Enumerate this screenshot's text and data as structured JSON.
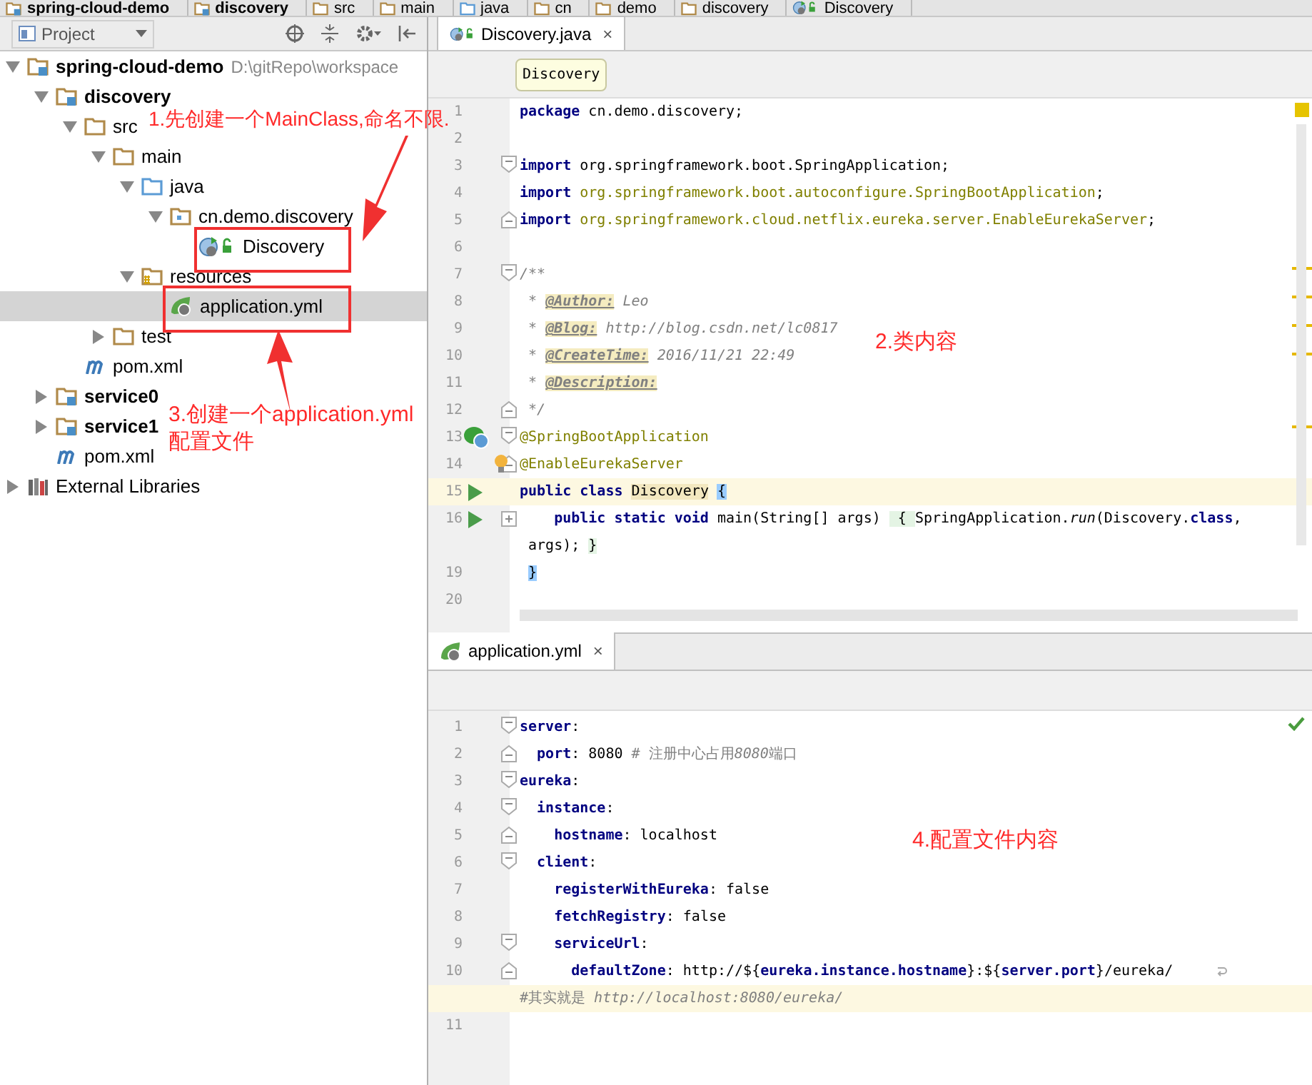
{
  "breadcrumbs": [
    {
      "label": "spring-cloud-demo",
      "kind": "module"
    },
    {
      "label": "discovery",
      "kind": "module"
    },
    {
      "label": "src",
      "kind": "folder"
    },
    {
      "label": "main",
      "kind": "folder"
    },
    {
      "label": "java",
      "kind": "source"
    },
    {
      "label": "cn",
      "kind": "folder"
    },
    {
      "label": "demo",
      "kind": "folder"
    },
    {
      "label": "discovery",
      "kind": "folder"
    },
    {
      "label": "Discovery",
      "kind": "spring-class"
    }
  ],
  "project_panel": {
    "title": "Project",
    "tree": [
      {
        "label": "spring-cloud-demo",
        "kind": "module",
        "detail": "D:\\gitRepo\\workspace",
        "expanded": true,
        "selected": false,
        "children": [
          {
            "label": "discovery",
            "kind": "module",
            "expanded": true,
            "selected": false,
            "children": [
              {
                "label": "src",
                "kind": "folder",
                "expanded": true,
                "selected": false,
                "children": [
                  {
                    "label": "main",
                    "kind": "folder",
                    "expanded": true,
                    "selected": false,
                    "children": [
                      {
                        "label": "java",
                        "kind": "source",
                        "expanded": true,
                        "selected": false,
                        "children": [
                          {
                            "label": "cn.demo.discovery",
                            "kind": "package",
                            "expanded": true,
                            "selected": false,
                            "children": [
                              {
                                "label": "Discovery",
                                "kind": "spring-class",
                                "selected": false
                              }
                            ]
                          }
                        ]
                      },
                      {
                        "label": "resources",
                        "kind": "resources",
                        "expanded": true,
                        "selected": false,
                        "children": [
                          {
                            "label": "application.yml",
                            "kind": "yml",
                            "selected": true
                          }
                        ]
                      }
                    ]
                  },
                  {
                    "label": "test",
                    "kind": "folder",
                    "expanded": false,
                    "selected": false
                  }
                ]
              },
              {
                "label": "pom.xml",
                "kind": "maven",
                "selected": false
              }
            ]
          },
          {
            "label": "service0",
            "kind": "module",
            "expanded": false,
            "selected": false
          },
          {
            "label": "service1",
            "kind": "module",
            "expanded": false,
            "selected": false
          },
          {
            "label": "pom.xml",
            "kind": "maven",
            "selected": false
          }
        ]
      },
      {
        "label": "External Libraries",
        "kind": "library",
        "expanded": false,
        "selected": false
      }
    ]
  },
  "editor_java": {
    "tab": {
      "label": "Discovery.java",
      "close": "×"
    },
    "crumb": "Discovery",
    "lines": [
      {
        "number": "1",
        "tokens": [
          {
            "kind": "keyword",
            "text": "package"
          },
          {
            "kind": "plain",
            "text": " cn.demo.discovery;"
          }
        ]
      },
      {
        "number": "2"
      },
      {
        "number": "3",
        "fold_start": true,
        "tokens": [
          {
            "kind": "keyword",
            "text": "import"
          },
          {
            "kind": "plain",
            "text": " org.springframework.boot.SpringApplication;"
          }
        ]
      },
      {
        "number": "4",
        "tokens": [
          {
            "kind": "keyword",
            "text": "import"
          },
          {
            "kind": "unused",
            "text": " org.springframework.boot.autoconfigure.SpringBootApplication"
          },
          {
            "kind": "plain",
            "text": ";"
          }
        ]
      },
      {
        "number": "5",
        "fold_end": true,
        "tokens": [
          {
            "kind": "keyword",
            "text": "import"
          },
          {
            "kind": "unused",
            "text": " org.springframework.cloud.netflix.eureka.server.EnableEurekaServer"
          },
          {
            "kind": "plain",
            "text": ";"
          }
        ]
      },
      {
        "number": "6"
      },
      {
        "number": "7",
        "fold_start": true,
        "tokens": [
          {
            "kind": "doc",
            "text": "/**"
          }
        ]
      },
      {
        "number": "8",
        "tokens": [
          {
            "kind": "doc",
            "text": " * "
          },
          {
            "kind": "doctag",
            "text": "@Author:"
          },
          {
            "kind": "doc",
            "text": " Leo"
          }
        ]
      },
      {
        "number": "9",
        "tokens": [
          {
            "kind": "doc",
            "text": " * "
          },
          {
            "kind": "doctag",
            "text": "@Blog:"
          },
          {
            "kind": "doc",
            "text": " http://blog.csdn.net/lc0817"
          }
        ]
      },
      {
        "number": "10",
        "tokens": [
          {
            "kind": "doc",
            "text": " * "
          },
          {
            "kind": "doctag",
            "text": "@CreateTime:"
          },
          {
            "kind": "doc",
            "text": " 2016/11/21 22:49"
          }
        ]
      },
      {
        "number": "11",
        "tokens": [
          {
            "kind": "doc",
            "text": " * "
          },
          {
            "kind": "doctag",
            "text": "@Description:"
          }
        ]
      },
      {
        "number": "12",
        "fold_end": true,
        "tokens": [
          {
            "kind": "doc",
            "text": " */"
          }
        ]
      },
      {
        "number": "13",
        "bean_marker": true,
        "fold_start": true,
        "tokens": [
          {
            "kind": "annotation",
            "text": "@SpringBootApplication"
          }
        ]
      },
      {
        "number": "14",
        "fold_end": true,
        "intention": true,
        "tokens": [
          {
            "kind": "annotation",
            "text": "@EnableEurekaServer"
          }
        ]
      },
      {
        "number": "15",
        "run_marker": true,
        "current": true,
        "tokens": [
          {
            "kind": "keyword",
            "text": "public class "
          },
          {
            "kind": "usage",
            "text": "Discovery"
          },
          {
            "kind": "brace",
            "text": "{"
          }
        ]
      },
      {
        "number": "16",
        "run_marker": true,
        "folded": true,
        "tokens": [
          {
            "kind": "keyword",
            "text": "    public static void"
          },
          {
            "kind": "plain",
            "text": " main(String[] args) "
          },
          {
            "kind": "folded",
            "text": " { "
          },
          {
            "kind": "plain",
            "text": "SpringApplication."
          },
          {
            "kind": "italic",
            "text": "run"
          },
          {
            "kind": "plain",
            "text": "(Discovery."
          },
          {
            "kind": "keyword",
            "text": "class"
          },
          {
            "kind": "plain",
            "text": ","
          }
        ]
      },
      {
        "tokens": [
          {
            "kind": "plain",
            "text": " args); "
          },
          {
            "kind": "folded",
            "text": "}"
          }
        ]
      },
      {
        "number": "19",
        "tokens": [
          {
            "kind": "brace",
            "text": "}"
          }
        ]
      },
      {
        "number": "20"
      }
    ]
  },
  "editor_yml": {
    "tab": {
      "label": "application.yml",
      "close": "×"
    },
    "lines": [
      {
        "number": "1",
        "fold_start": true,
        "tokens": [
          {
            "kind": "keyword",
            "text": "server"
          },
          {
            "kind": "plain",
            "text": ":"
          }
        ]
      },
      {
        "number": "2",
        "fold_end": true,
        "tokens": [
          {
            "kind": "keyword",
            "text": "  port"
          },
          {
            "kind": "plain",
            "text": ": 8080 "
          },
          {
            "kind": "comment",
            "text": "# 注册中心占用"
          },
          {
            "kind": "italic-comment",
            "text": "8080"
          },
          {
            "kind": "comment",
            "text": "端口"
          }
        ]
      },
      {
        "number": "3",
        "fold_start": true,
        "tokens": [
          {
            "kind": "keyword",
            "text": "eureka"
          },
          {
            "kind": "plain",
            "text": ":"
          }
        ]
      },
      {
        "number": "4",
        "fold_start": true,
        "tokens": [
          {
            "kind": "keyword",
            "text": "  instance"
          },
          {
            "kind": "plain",
            "text": ":"
          }
        ]
      },
      {
        "number": "5",
        "fold_end": true,
        "tokens": [
          {
            "kind": "keyword",
            "text": "    hostname"
          },
          {
            "kind": "plain",
            "text": ": localhost"
          }
        ]
      },
      {
        "number": "6",
        "fold_start": true,
        "tokens": [
          {
            "kind": "keyword",
            "text": "  client"
          },
          {
            "kind": "plain",
            "text": ":"
          }
        ]
      },
      {
        "number": "7",
        "tokens": [
          {
            "kind": "keyword",
            "text": "    registerWithEureka"
          },
          {
            "kind": "plain",
            "text": ": false"
          }
        ]
      },
      {
        "number": "8",
        "tokens": [
          {
            "kind": "keyword",
            "text": "    fetchRegistry"
          },
          {
            "kind": "plain",
            "text": ": false"
          }
        ]
      },
      {
        "number": "9",
        "fold_start": true,
        "tokens": [
          {
            "kind": "keyword",
            "text": "    serviceUrl"
          },
          {
            "kind": "plain",
            "text": ":"
          }
        ]
      },
      {
        "number": "10",
        "fold_end": true,
        "wrapped": true,
        "tokens": [
          {
            "kind": "keyword",
            "text": "      defaultZone"
          },
          {
            "kind": "plain",
            "text": ": http://${"
          },
          {
            "kind": "keyword",
            "text": "eureka.instance.hostname"
          },
          {
            "kind": "plain",
            "text": "}:${"
          },
          {
            "kind": "keyword",
            "text": "server.port"
          },
          {
            "kind": "plain",
            "text": "}/eureka/"
          }
        ]
      },
      {
        "current": true,
        "tokens": [
          {
            "kind": "comment",
            "text": "#其实就是 "
          },
          {
            "kind": "italic-comment",
            "text": "http://localhost:8080/eureka/"
          }
        ]
      },
      {
        "number": "11"
      }
    ]
  },
  "annotations": [
    "1.先创建一个MainClass,命名不限.",
    "2.类内容",
    "3.创建一个application.yml配置文件",
    "4.配置文件内容"
  ]
}
